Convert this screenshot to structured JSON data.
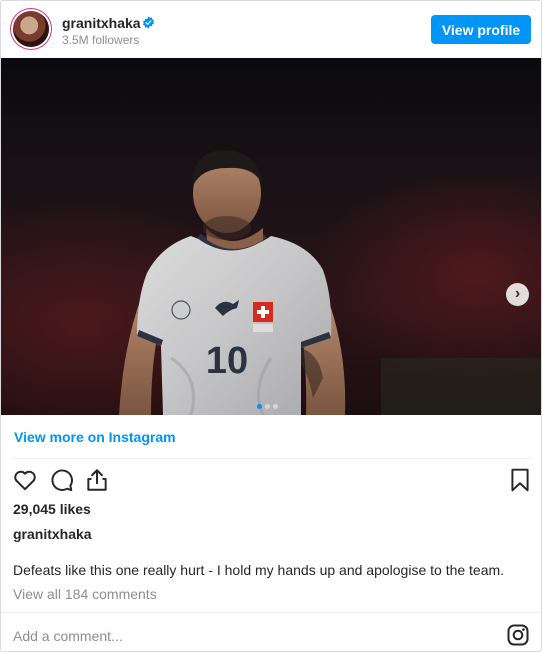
{
  "header": {
    "username": "granitxhaka",
    "followers": "3.5M followers",
    "view_profile_label": "View profile"
  },
  "photo": {
    "jersey_number": "10",
    "slides_total": 3,
    "active_slide": 1
  },
  "links": {
    "view_more": "View more on Instagram"
  },
  "post": {
    "likes": "29,045 likes",
    "caption_user": "granitxhaka",
    "caption": "Defeats like this one really hurt - I hold my hands up and apologise to the team.",
    "view_comments": "View all 184 comments",
    "add_comment_placeholder": "Add a comment..."
  },
  "icons": {
    "verified": "verified-badge-icon",
    "like": "heart-icon",
    "comment": "comment-icon",
    "share": "share-icon",
    "save": "bookmark-icon",
    "instagram": "instagram-icon",
    "next": "chevron-right-icon"
  },
  "colors": {
    "accent": "#0095f6",
    "text": "#262626",
    "muted": "#8e8e8e"
  }
}
